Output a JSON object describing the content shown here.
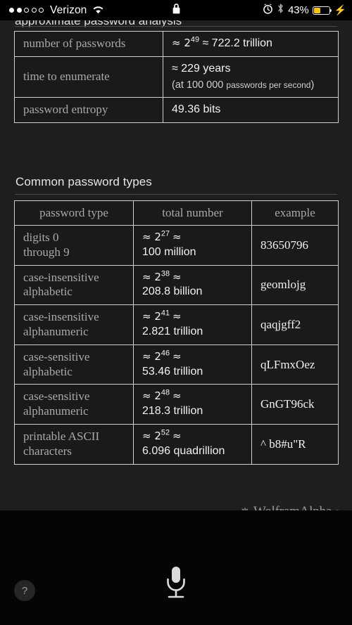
{
  "status_bar": {
    "signal_dots_total": 5,
    "signal_dots_filled": 2,
    "carrier": "Verizon",
    "wifi_icon": "wifi-icon",
    "lock_icon": "lock-icon",
    "alarm_icon": "alarm-clock-icon",
    "bluetooth_icon": "bluetooth-icon",
    "battery_percent": "43%",
    "battery_level": 43,
    "battery_color": "#f9c314",
    "charging_icon": "lightning-bolt-icon"
  },
  "content": {
    "clipped_heading": "approximate password analysis",
    "summary_table": {
      "rows": [
        {
          "label": "number of passwords",
          "value_prefix": "≈ 2",
          "value_exp": "49",
          "value_suffix": "≈ 722.2 trillion"
        },
        {
          "label": "time to enumerate",
          "value_main": "≈ 229 years",
          "value_note_lead": "(at 100 000 ",
          "value_note_small": "passwords per second",
          "value_note_tail": ")"
        },
        {
          "label": "password entropy",
          "value_main": "49.36 bits"
        }
      ]
    },
    "section_heading": "Common password types",
    "types_table": {
      "headers": [
        "password type",
        "total number",
        "example"
      ],
      "rows": [
        {
          "type_line1": "digits 0",
          "type_line2": "through 9",
          "total_prefix": "≈ 2",
          "total_exp": "27",
          "total_approx": "≈",
          "total_value": "100 million",
          "example": "83650796"
        },
        {
          "type_line1": "case-insensitive",
          "type_line2": "alphabetic",
          "total_prefix": "≈ 2",
          "total_exp": "38",
          "total_approx": "≈",
          "total_value": "208.8 billion",
          "example": "geomlojg"
        },
        {
          "type_line1": "case-insensitive",
          "type_line2": "alphanumeric",
          "total_prefix": "≈ 2",
          "total_exp": "41",
          "total_approx": "≈",
          "total_value": "2.821 trillion",
          "example": "qaqjgff2"
        },
        {
          "type_line1": "case-sensitive",
          "type_line2": "alphabetic",
          "total_prefix": "≈ 2",
          "total_exp": "46",
          "total_approx": "≈",
          "total_value": "53.46 trillion",
          "example": "qLFmxOez"
        },
        {
          "type_line1": "case-sensitive",
          "type_line2": "alphanumeric",
          "total_prefix": "≈ 2",
          "total_exp": "48",
          "total_approx": "≈",
          "total_value": "218.3 trillion",
          "example": "GnGT96ck"
        },
        {
          "type_line1": "printable ASCII",
          "type_line2": "characters",
          "total_prefix": "≈ 2",
          "total_exp": "52",
          "total_approx": "≈",
          "total_value": "6.096 quadrillion",
          "example": "^ b8#u\"R"
        }
      ]
    },
    "brand": {
      "mark_icon": "wolfram-spikey-icon",
      "name": "WolframAlpha",
      "trademark": "®"
    }
  },
  "bottom_bar": {
    "help_label": "?",
    "mic_icon": "microphone-icon"
  }
}
